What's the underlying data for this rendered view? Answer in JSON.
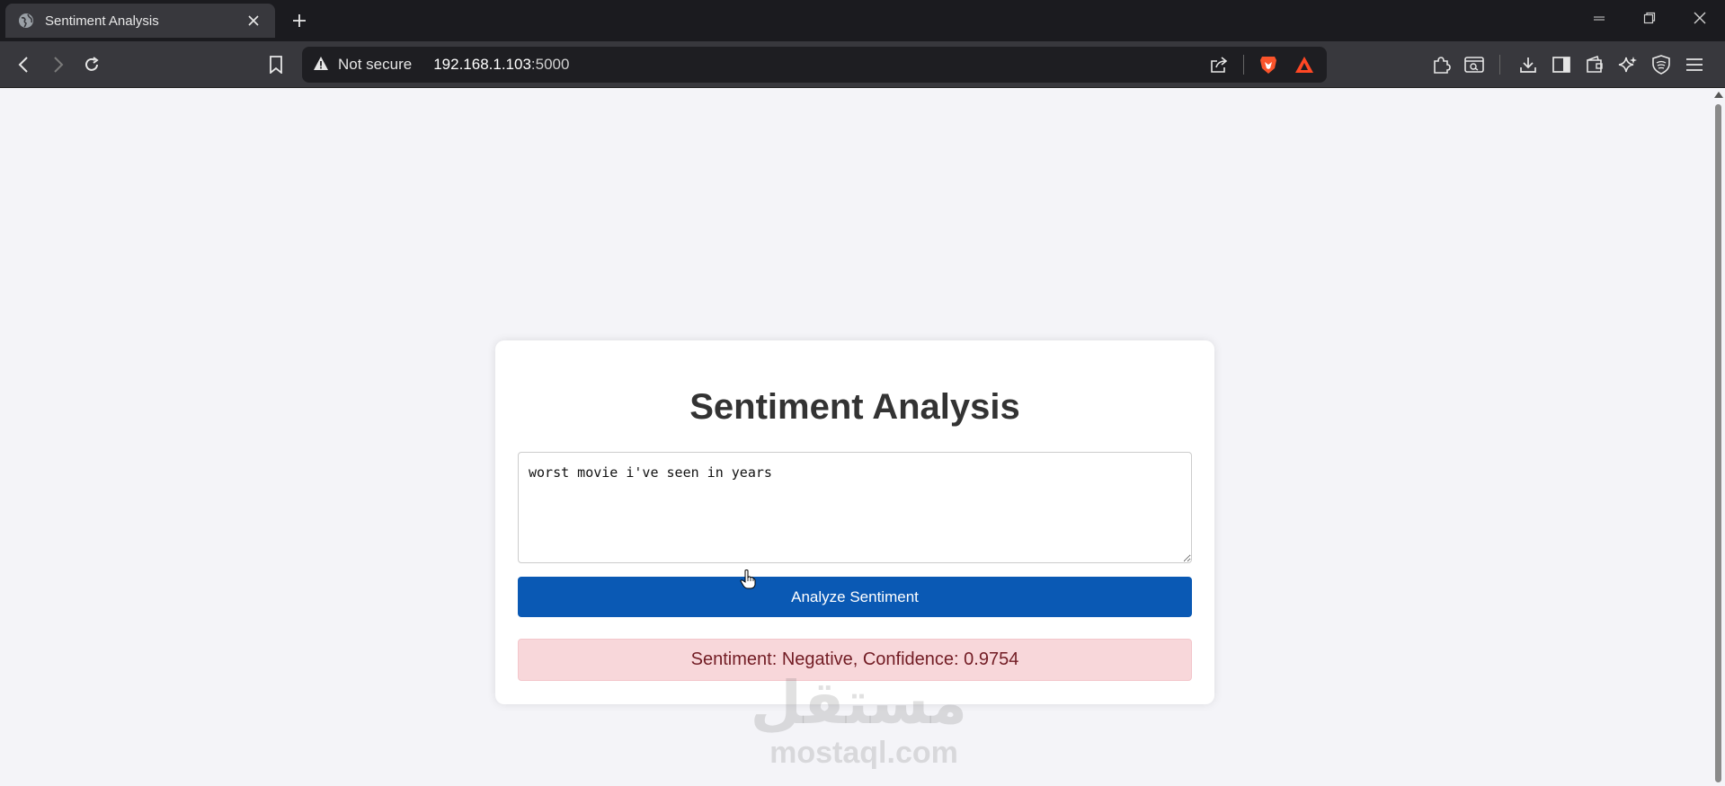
{
  "browser": {
    "tab": {
      "title": "Sentiment Analysis",
      "favicon": "globe-icon"
    },
    "address": {
      "security_label": "Not secure",
      "url_host": "192.168.1.103",
      "url_port": ":5000"
    },
    "icons": {
      "back": "back-arrow-icon",
      "forward": "forward-arrow-icon",
      "reload": "reload-icon",
      "bookmark": "bookmark-icon",
      "share": "share-icon",
      "brave_shields": "brave-lion-icon",
      "brave_rewards": "brave-rewards-triangle-icon",
      "extensions": "puzzle-icon",
      "leo": "leo-search-icon",
      "downloads": "download-icon",
      "sidebar": "sidebar-icon",
      "wallet": "wallet-icon",
      "ai": "sparkle-icon",
      "vpn": "shield-icon",
      "menu": "hamburger-icon"
    }
  },
  "app": {
    "title": "Sentiment Analysis",
    "input_text": "worst movie i've seen in years",
    "analyze_button_label": "Analyze Sentiment",
    "result_text": "Sentiment: Negative, Confidence: 0.9754",
    "colors": {
      "button": "#0a59b4",
      "result_bg": "#f8d7da",
      "result_text": "#721c24"
    }
  },
  "watermark": {
    "arabic": "مستقل",
    "latin": "mostaql.com"
  }
}
